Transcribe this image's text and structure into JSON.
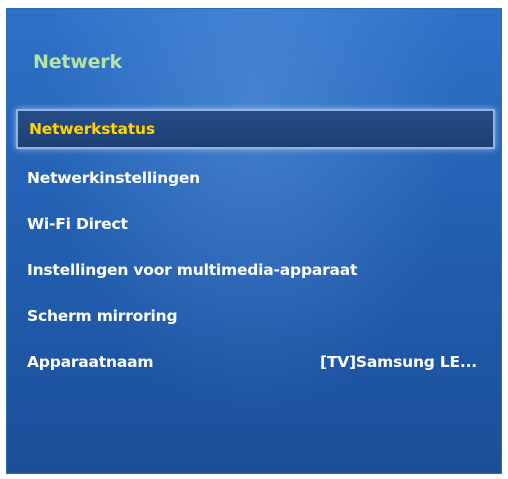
{
  "menu": {
    "title": "Netwerk",
    "items": [
      {
        "label": "Netwerkstatus",
        "selected": true
      },
      {
        "label": "Netwerkinstellingen"
      },
      {
        "label": "Wi-Fi Direct"
      },
      {
        "label": "Instellingen voor multimedia-apparaat"
      },
      {
        "label": "Scherm mirroring"
      },
      {
        "label": "Apparaatnaam",
        "value": "[TV]Samsung LE..."
      }
    ]
  },
  "colors": {
    "title": "#b6e3a6",
    "selected_text": "#ffd400",
    "item_text": "#ffffff",
    "panel_background": "#2563b6"
  }
}
